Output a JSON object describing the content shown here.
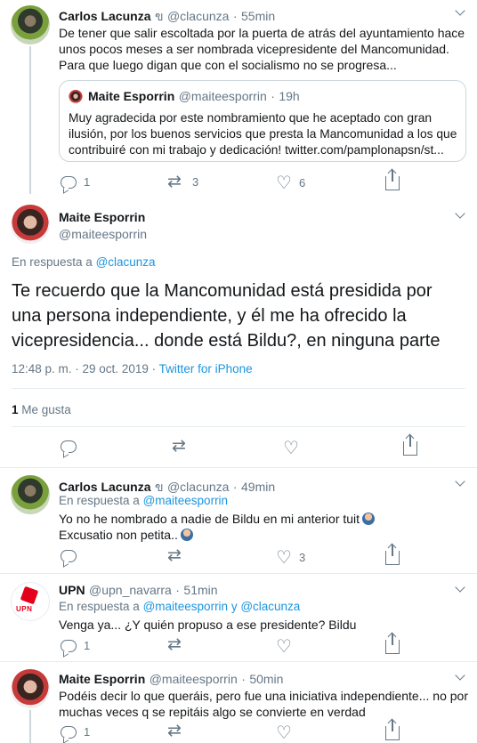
{
  "tweets": [
    {
      "name": "Carlos Lacunza",
      "name_suffix": "ข",
      "handle": "@clacunza",
      "time": "55min",
      "lines": [
        "De tener que salir escoltada por la puerta de atrás del ayuntamiento hace",
        "unos pocos meses a ser nombrada vicepresidente del Mancomunidad.",
        "Para que luego digan que con el socialismo no se progresa..."
      ],
      "quote": {
        "name": "Maite Esporrin",
        "handle": "@maiteesporrin",
        "time": "19h",
        "lines": [
          "Muy agradecida por este nombramiento que he aceptado con gran",
          "ilusión,  por los buenos servicios que presta la Mancomunidad a los que",
          "contribuiré con mi trabajo y dedicación! twitter.com/pamplonapsn/st..."
        ]
      },
      "replies": "1",
      "retweets": "3",
      "likes": "6"
    },
    {
      "name": "Maite Esporrin",
      "handle": "@maiteesporrin",
      "reply_prefix": "En respuesta a",
      "reply_to": "@clacunza",
      "lines": [
        "Te recuerdo que la Mancomunidad está presidida por",
        "una persona independiente, y él me ha ofrecido la",
        "vicepresidencia... donde está Bildu?, en ninguna parte"
      ],
      "time": "12:48 p. m. · 29 oct. 2019 ·",
      "source": "Twitter for iPhone",
      "likes_count": "1",
      "likes_label": "Me gusta"
    },
    {
      "name": "Carlos Lacunza",
      "name_suffix": "ข",
      "handle": "@clacunza",
      "time": "49min",
      "reply_prefix": "En respuesta a",
      "reply_to": "@maiteesporrin",
      "lines": [
        "Yo no he nombrado a nadie de Bildu en mi anterior tuit",
        "Excusatio non petita.."
      ],
      "replies": "",
      "retweets": "",
      "likes": "3"
    },
    {
      "name": "UPN",
      "handle": "@upn_navarra",
      "time": "51min",
      "logo_text": "UPN",
      "reply_prefix": "En respuesta a",
      "reply_to": "@maiteesporrin y @clacunza",
      "lines": [
        "Venga ya... ¿Y quién propuso a ese presidente? Bildu"
      ],
      "replies": "1",
      "retweets": "",
      "likes": ""
    },
    {
      "name": "Maite Esporrin",
      "handle": "@maiteesporrin",
      "time": "50min",
      "lines": [
        "Podéis decir lo que queráis, pero fue una iniciativa independiente... no por",
        "muchas veces q se repitáis algo se convierte en verdad"
      ],
      "replies": "1",
      "retweets": "",
      "likes": ""
    }
  ],
  "icons": {
    "reply": "reply-icon",
    "retweet": "retweet-icon",
    "like": "heart-icon",
    "share": "share-icon",
    "more": "chevron-down-icon"
  },
  "colors": {
    "link": "#1b95e0",
    "secondary_text": "#657786",
    "border": "#e6ecf0",
    "upn_red": "#e3001b"
  }
}
